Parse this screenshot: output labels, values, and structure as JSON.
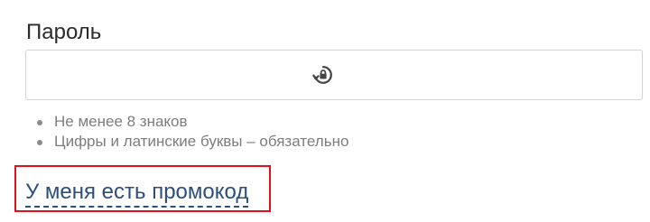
{
  "password": {
    "label": "Пароль",
    "value": "",
    "toggle_icon": "lock-refresh-icon"
  },
  "hints": [
    "Не менее 8 знаков",
    "Цифры и латинские буквы – обязательно"
  ],
  "promo": {
    "link_text": "У меня есть промокод",
    "highlight_color": "#e0111b",
    "link_color": "#2c4f7c"
  }
}
